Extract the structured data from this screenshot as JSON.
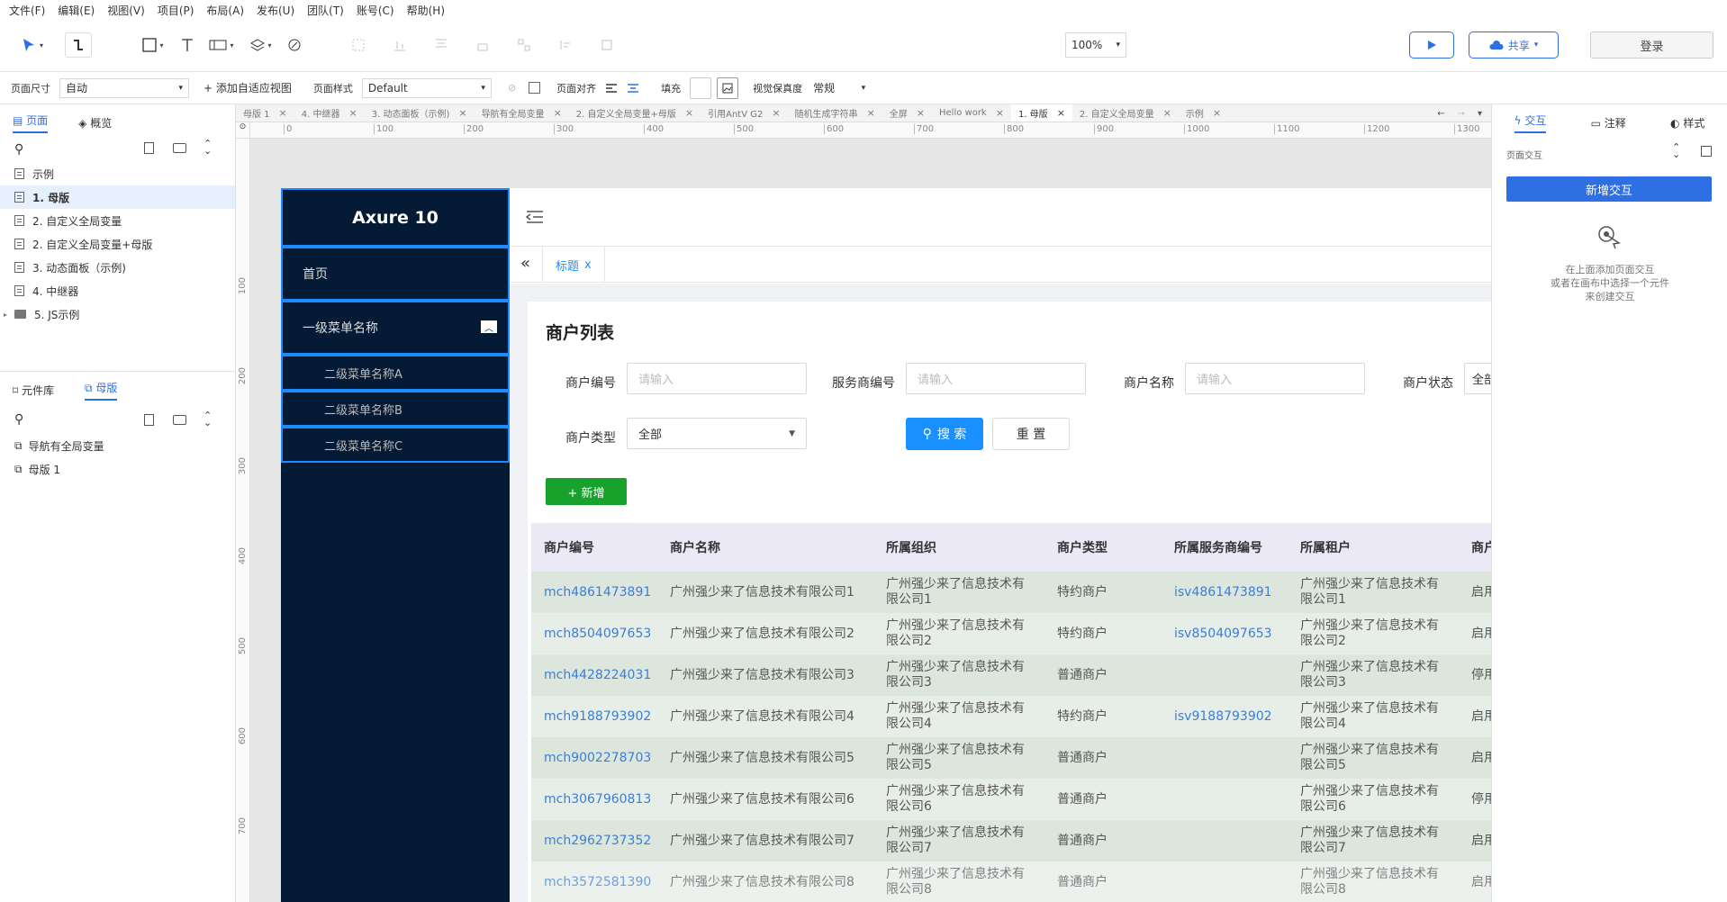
{
  "menu": [
    "文件(F)",
    "编辑(E)",
    "视图(V)",
    "项目(P)",
    "布局(A)",
    "发布(U)",
    "团队(T)",
    "账号(C)",
    "帮助(H)"
  ],
  "toolbar": {
    "zoom": "100%",
    "share": "共享",
    "login": "登录"
  },
  "propbar": {
    "page_size_label": "页面尺寸",
    "page_size_value": "自动",
    "adaptive": "+ 添加自适应视图",
    "page_style_label": "页面样式",
    "page_style_value": "Default",
    "align_label": "页面对齐",
    "fill_label": "填充",
    "quality_label": "视觉保真度",
    "quality_value": "常规"
  },
  "left": {
    "tab_pages": "页面",
    "tab_overview": "概览",
    "pages": [
      "示例",
      "1. 母版",
      "2. 自定义全局变量",
      "2. 自定义全局变量+母版",
      "3. 动态面板（示例)",
      "4. 中继器",
      "5. JS示例"
    ],
    "tab_library": "元件库",
    "tab_masters": "母版",
    "masters": [
      "导航有全局变量",
      "母版 1"
    ]
  },
  "tabs": [
    "母版 1",
    "4. 中继器",
    "3. 动态面板（示例)",
    "导航有全局变量",
    "2. 自定义全局变量+母版",
    "引用AntV G2",
    "随机生成字符串",
    "全屏",
    "Hello work",
    "1. 母版",
    "2. 自定义全局变量",
    "示例"
  ],
  "ruler_h": [
    "0",
    "100",
    "200",
    "300",
    "400",
    "500",
    "600",
    "700",
    "800",
    "900",
    "1000",
    "1100",
    "1200",
    "1300"
  ],
  "ruler_v": [
    "100",
    "200",
    "300",
    "400",
    "500",
    "600",
    "700"
  ],
  "right": {
    "tab_interact": "交互",
    "tab_notes": "注释",
    "tab_style": "样式",
    "page_interact": "页面交互",
    "add_button": "新增交互",
    "hint_1": "在上面添加页面交互",
    "hint_2": "或者在画布中选择一个元件",
    "hint_3": "来创建交互"
  },
  "proto": {
    "logo": "Axure 10",
    "nav_home": "首页",
    "nav_level1": "一级菜单名称",
    "nav_level2": [
      "二级菜单名称A",
      "二级菜单名称B",
      "二级菜单名称C"
    ],
    "tab_title": "标题",
    "tab_close": "x",
    "page_title": "商户列表",
    "f_merchant_no": "商户编号",
    "f_service_no": "服务商编号",
    "f_merchant_name": "商户名称",
    "f_status": "商户状态",
    "placeholder": "请输入",
    "status_value": "全部",
    "f_type": "商户类型",
    "type_value": "全部",
    "search": "搜 索",
    "reset": "重 置",
    "add": "+ 新增",
    "columns": [
      "商户编号",
      "商户名称",
      "所属组织",
      "商户类型",
      "所属服务商编号",
      "所属租户",
      "商户"
    ],
    "rows": [
      [
        "mch4861473891",
        "广州强少来了信息技术有限公司1",
        "广州强少来了信息技术有限公司1",
        "特约商户",
        "isv4861473891",
        "广州强少来了信息技术有限公司1",
        "启用"
      ],
      [
        "mch8504097653",
        "广州强少来了信息技术有限公司2",
        "广州强少来了信息技术有限公司2",
        "特约商户",
        "isv8504097653",
        "广州强少来了信息技术有限公司2",
        "启用"
      ],
      [
        "mch4428224031",
        "广州强少来了信息技术有限公司3",
        "广州强少来了信息技术有限公司3",
        "普通商户",
        "",
        "广州强少来了信息技术有限公司3",
        "停用"
      ],
      [
        "mch9188793902",
        "广州强少来了信息技术有限公司4",
        "广州强少来了信息技术有限公司4",
        "特约商户",
        "isv9188793902",
        "广州强少来了信息技术有限公司4",
        "启用"
      ],
      [
        "mch9002278703",
        "广州强少来了信息技术有限公司5",
        "广州强少来了信息技术有限公司5",
        "普通商户",
        "",
        "广州强少来了信息技术有限公司5",
        "启用"
      ],
      [
        "mch3067960813",
        "广州强少来了信息技术有限公司6",
        "广州强少来了信息技术有限公司6",
        "普通商户",
        "",
        "广州强少来了信息技术有限公司6",
        "停用"
      ],
      [
        "mch2962737352",
        "广州强少来了信息技术有限公司7",
        "广州强少来了信息技术有限公司7",
        "普通商户",
        "",
        "广州强少来了信息技术有限公司7",
        "启用"
      ],
      [
        "mch3572581390",
        "广州强少来了信息技术有限公司8",
        "广州强少来了信息技术有限公司8",
        "普通商户",
        "",
        "广州强少来了信息技术有限公司8",
        "启用"
      ]
    ]
  },
  "colors": {
    "accent": "#2f6fe4",
    "nav_bg": "#041a35",
    "primary_btn": "#1890ff",
    "add_btn": "#17a22b"
  }
}
